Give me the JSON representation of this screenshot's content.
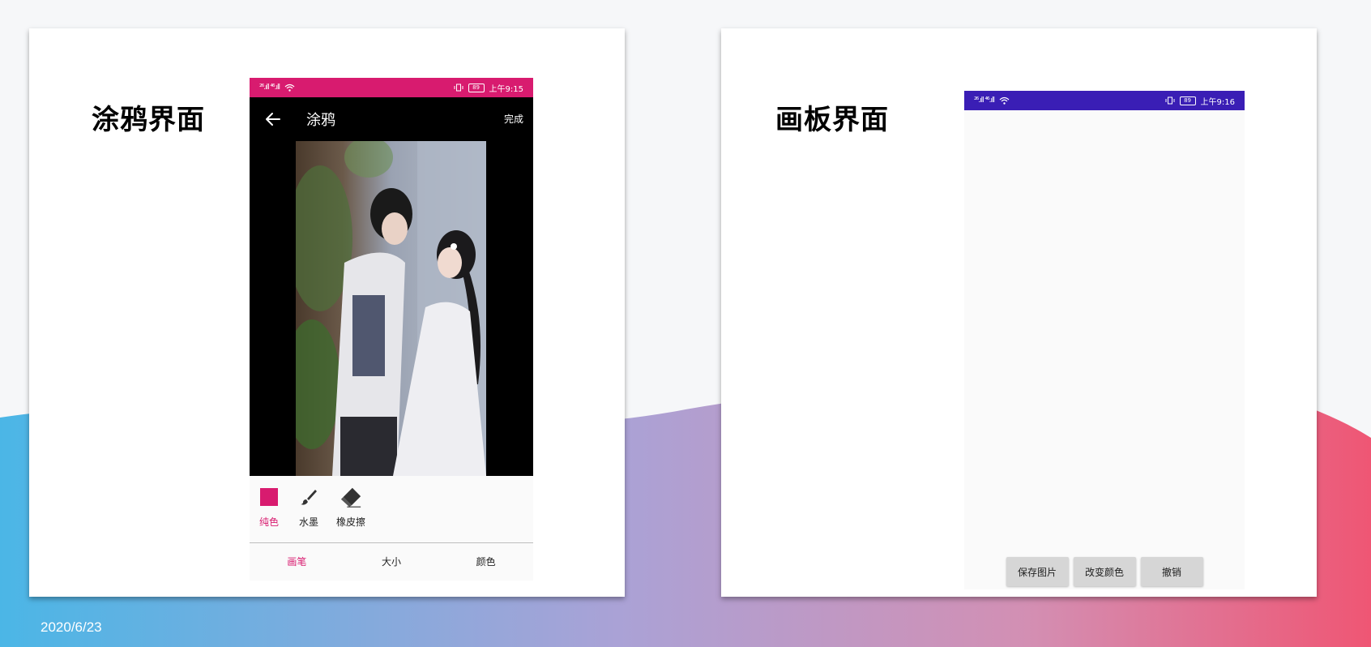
{
  "colors": {
    "accent_pink": "#d81b6f",
    "accent_purple": "#3a1eb5",
    "wave_left": "#4bb6e6",
    "wave_mid": "#b8a0cf",
    "wave_right": "#ef5674"
  },
  "footer": {
    "date": "2020/6/23"
  },
  "left_card": {
    "title": "涂鸦界面",
    "phone": {
      "status": {
        "signal": "²⁶.ıll ⁴⁶.ıll",
        "battery": "89",
        "time": "上午9:15"
      },
      "toolbar": {
        "title": "涂鸦",
        "done_label": "完成",
        "back_icon": "arrow-left-icon"
      },
      "tools": [
        {
          "label": "纯色",
          "icon": "solid-color-swatch-icon",
          "selected": true
        },
        {
          "label": "水墨",
          "icon": "brush-icon",
          "selected": false
        },
        {
          "label": "橡皮擦",
          "icon": "eraser-icon",
          "selected": false
        }
      ],
      "tabs": [
        {
          "label": "画笔",
          "selected": true
        },
        {
          "label": "大小",
          "selected": false
        },
        {
          "label": "颜色",
          "selected": false
        }
      ]
    }
  },
  "right_card": {
    "title": "画板界面",
    "phone": {
      "status": {
        "signal": "²⁶.ıll ⁴⁶.ıll",
        "battery": "89",
        "time": "上午9:16"
      },
      "buttons": [
        {
          "label": "保存图片"
        },
        {
          "label": "改变颜色"
        },
        {
          "label": "撤销"
        }
      ]
    }
  }
}
